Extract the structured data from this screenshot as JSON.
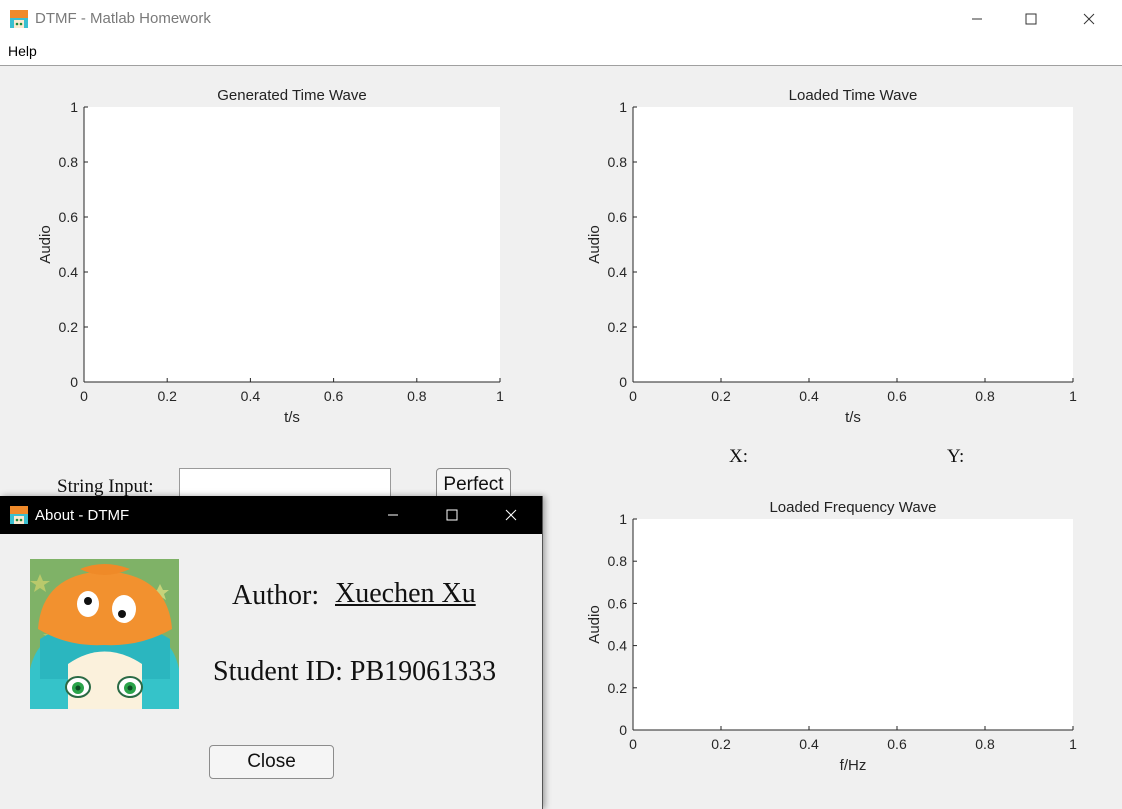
{
  "window": {
    "title": "DTMF - Matlab Homework",
    "minimize_icon": "minimize-icon",
    "maximize_icon": "maximize-icon",
    "close_icon": "close-icon"
  },
  "menu": {
    "items": [
      "Help"
    ]
  },
  "charts": {
    "generated_time": {
      "title": "Generated Time Wave",
      "xlabel": "t/s",
      "ylabel": "Audio"
    },
    "loaded_time": {
      "title": "Loaded Time Wave",
      "xlabel": "t/s",
      "ylabel": "Audio"
    },
    "loaded_freq": {
      "title": "Loaded Frequency Wave",
      "xlabel": "f/Hz",
      "ylabel": "Audio"
    }
  },
  "chart_data": [
    {
      "type": "line",
      "title": "Generated Time Wave",
      "xlabel": "t/s",
      "ylabel": "Audio",
      "xlim": [
        0,
        1
      ],
      "ylim": [
        0,
        1
      ],
      "xticks": [
        "0",
        "0.2",
        "0.4",
        "0.6",
        "0.8",
        "1"
      ],
      "yticks": [
        "0",
        "0.2",
        "0.4",
        "0.6",
        "0.8",
        "1"
      ],
      "series": []
    },
    {
      "type": "line",
      "title": "Loaded Time Wave",
      "xlabel": "t/s",
      "ylabel": "Audio",
      "xlim": [
        0,
        1
      ],
      "ylim": [
        0,
        1
      ],
      "xticks": [
        "0",
        "0.2",
        "0.4",
        "0.6",
        "0.8",
        "1"
      ],
      "yticks": [
        "0",
        "0.2",
        "0.4",
        "0.6",
        "0.8",
        "1"
      ],
      "series": []
    },
    {
      "type": "line",
      "title": "Loaded Frequency Wave",
      "xlabel": "f/Hz",
      "ylabel": "Audio",
      "xlim": [
        0,
        1
      ],
      "ylim": [
        0,
        1
      ],
      "xticks": [
        "0",
        "0.2",
        "0.4",
        "0.6",
        "0.8",
        "1"
      ],
      "yticks": [
        "0",
        "0.2",
        "0.4",
        "0.6",
        "0.8",
        "1"
      ],
      "series": []
    }
  ],
  "controls": {
    "string_input_label": "String Input:",
    "string_input_value": "",
    "perfect_button": "Perfect",
    "x_label": "X:",
    "y_label": "Y:"
  },
  "about": {
    "title": "About - DTMF",
    "author_label": "Author:",
    "author_name": "Xuechen Xu",
    "student_id_label": "Student ID: PB19061333",
    "close_button": "Close",
    "avatar": "avatar-image"
  },
  "colors": {
    "titlebar_active": "#000000",
    "background": "#f0f0f0",
    "axes_bg": "#ffffff"
  }
}
